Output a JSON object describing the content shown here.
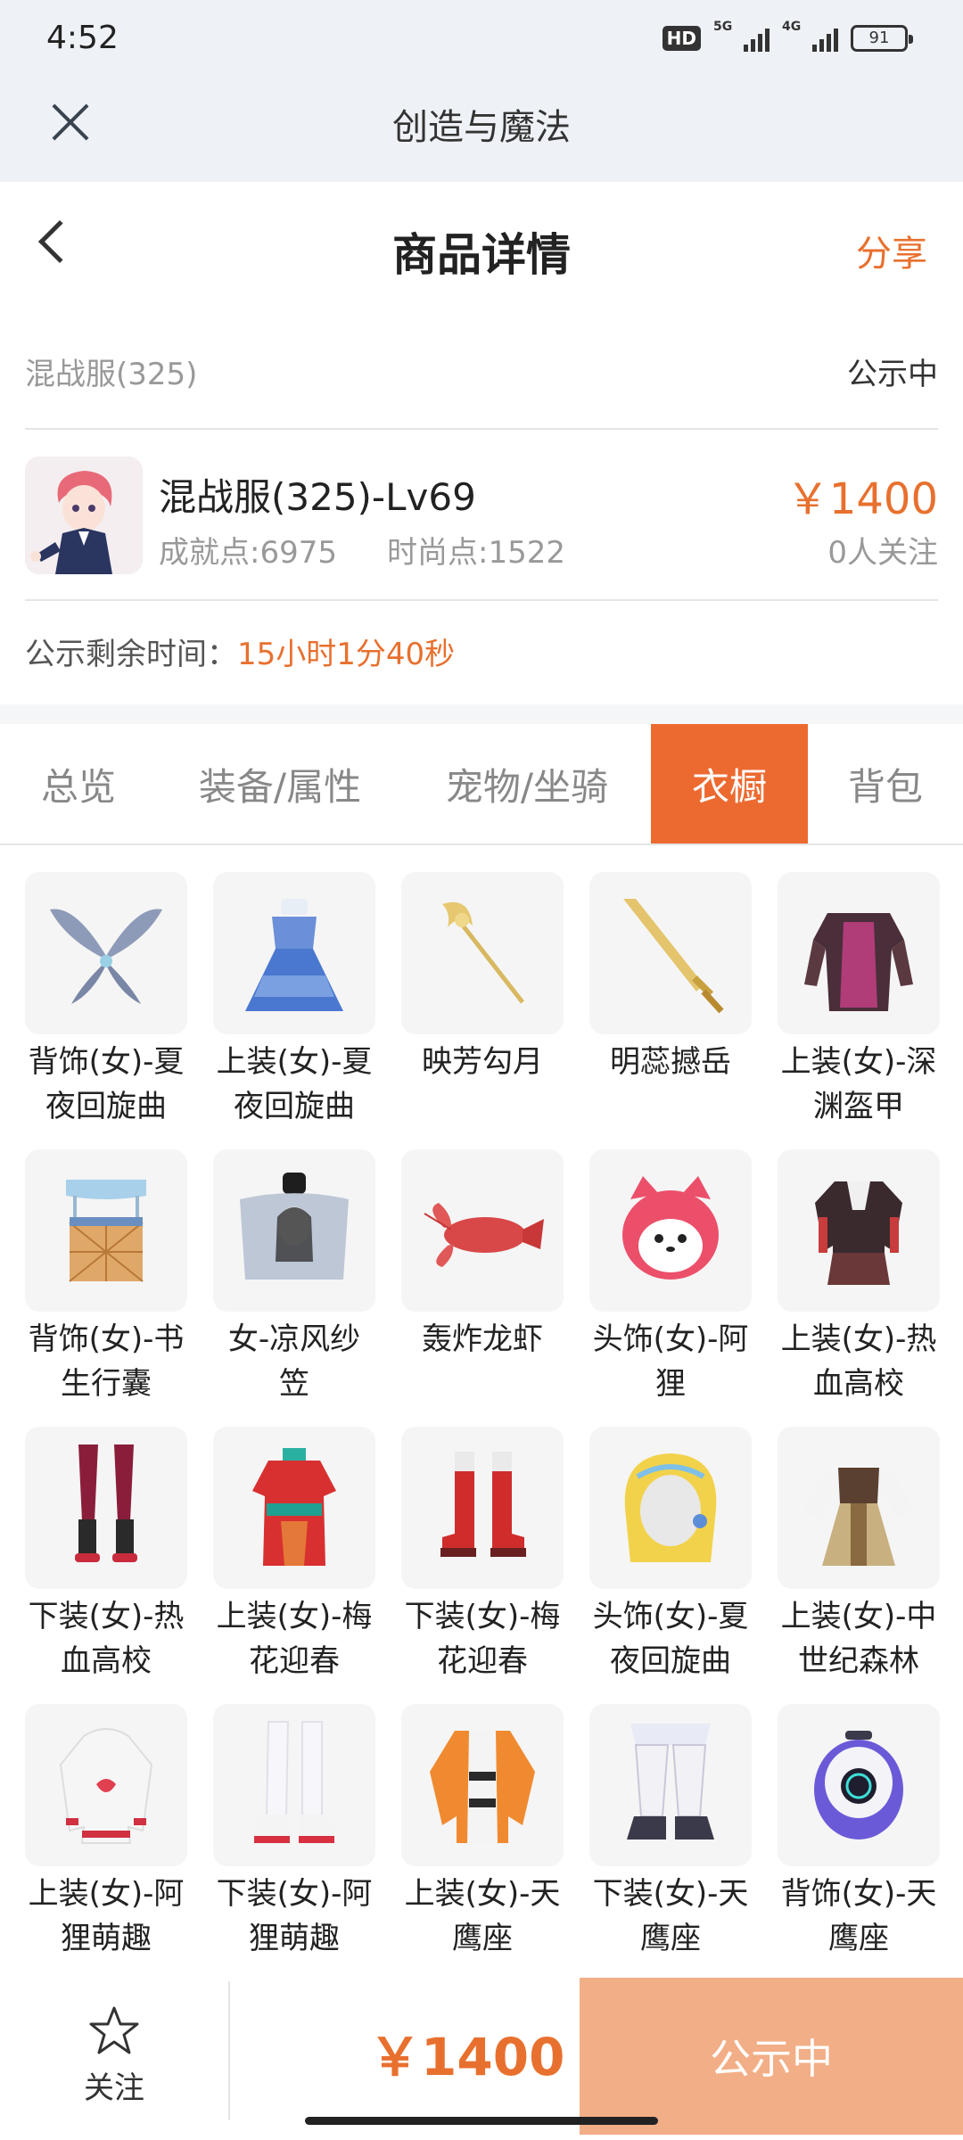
{
  "statusbar": {
    "time": "4:52",
    "hd": "HD",
    "net_5g": "5G",
    "net_4g": "4G",
    "battery": "91"
  },
  "appbar": {
    "title": "创造与魔法"
  },
  "navbar": {
    "title": "商品详情",
    "share": "分享"
  },
  "server": {
    "name": "混战服(325)",
    "status": "公示中"
  },
  "product": {
    "name": "混战服(325)-Lv69",
    "achievement": "成就点:6975",
    "fashion": "时尚点:1522",
    "price": "￥1400",
    "followers": "0人关注"
  },
  "countdown": {
    "label": "公示剩余时间：",
    "value": "15小时1分40秒"
  },
  "tabs": [
    {
      "label": "总览"
    },
    {
      "label": "装备/属性"
    },
    {
      "label": "宠物/坐骑"
    },
    {
      "label": "衣橱"
    },
    {
      "label": "背包"
    }
  ],
  "items": [
    {
      "label": "背饰(女)-夏夜回旋曲",
      "icon": "butterfly-wings-icon"
    },
    {
      "label": "上装(女)-夏夜回旋曲",
      "icon": "blue-dress-icon"
    },
    {
      "label": "映芳勾月",
      "icon": "golden-staff-icon"
    },
    {
      "label": "明蕊撼岳",
      "icon": "golden-sword-icon"
    },
    {
      "label": "上装(女)-深渊盔甲",
      "icon": "dark-armor-icon"
    },
    {
      "label": "背饰(女)-书生行囊",
      "icon": "scholar-backpack-icon"
    },
    {
      "label": "女-凉风纱笠",
      "icon": "veil-hat-icon"
    },
    {
      "label": "轰炸龙虾",
      "icon": "lobster-icon"
    },
    {
      "label": "头饰(女)-阿狸",
      "icon": "ali-fox-head-icon"
    },
    {
      "label": "上装(女)-热血高校",
      "icon": "school-uniform-top-icon"
    },
    {
      "label": "下装(女)-热血高校",
      "icon": "leggings-boots-icon"
    },
    {
      "label": "上装(女)-梅花迎春",
      "icon": "red-qipao-icon"
    },
    {
      "label": "下装(女)-梅花迎春",
      "icon": "red-boots-icon"
    },
    {
      "label": "头饰(女)-夏夜回旋曲",
      "icon": "blonde-wig-icon"
    },
    {
      "label": "上装(女)-中世纪森林",
      "icon": "medieval-dress-icon"
    },
    {
      "label": "上装(女)-阿狸萌趣",
      "icon": "white-hoodie-icon"
    },
    {
      "label": "下装(女)-阿狸萌趣",
      "icon": "white-stockings-icon"
    },
    {
      "label": "上装(女)-天鹰座",
      "icon": "orange-jacket-icon"
    },
    {
      "label": "下装(女)-天鹰座",
      "icon": "white-mech-pants-icon"
    },
    {
      "label": "背饰(女)-天鹰座",
      "icon": "robot-pod-icon"
    }
  ],
  "bottombar": {
    "follow": "关注",
    "price": "￥1400",
    "action": "公示中"
  },
  "colors": {
    "accent": "#e8702e",
    "tab_active": "#ec6a30",
    "button": "#f2ae86"
  }
}
